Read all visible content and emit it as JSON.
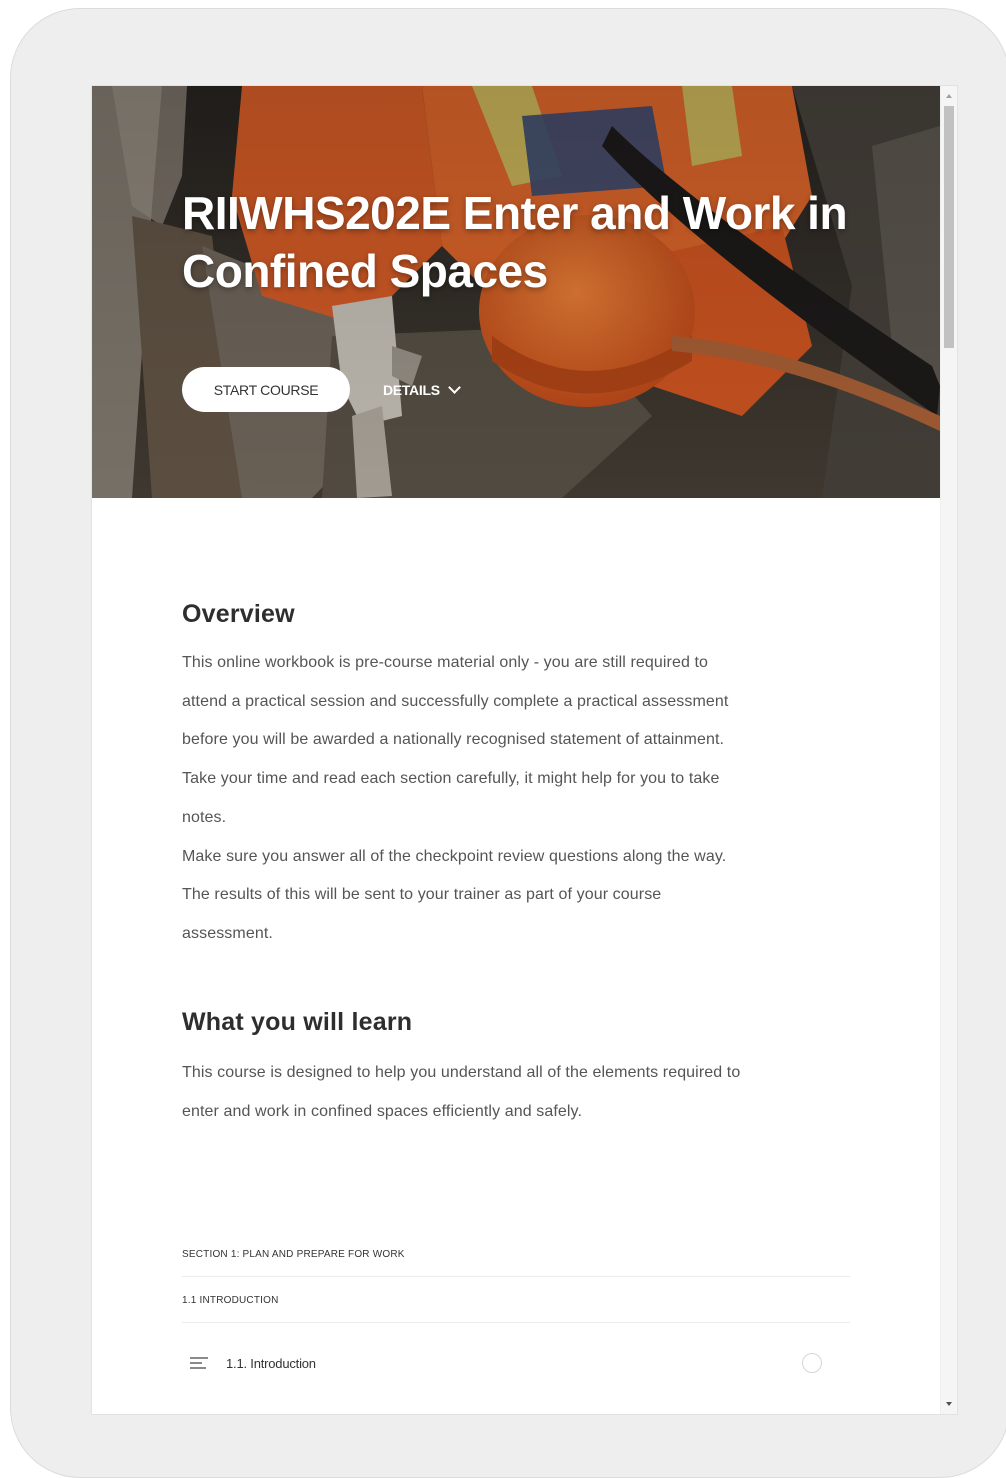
{
  "course": {
    "title": "RIIWHS202E Enter and Work in Confined Spaces",
    "start_label": "START COURSE",
    "details_label": "DETAILS"
  },
  "overview": {
    "heading": "Overview",
    "lines": [
      "This online workbook is pre-course material only - you are still required to",
      "attend a practical session and successfully complete a practical assessment",
      "before you will be awarded a nationally recognised statement of attainment.",
      "Take your time and read each section carefully, it might help for you to take",
      "notes.",
      "Make sure you answer all of the checkpoint review questions along the way.",
      "The results of this will be sent to your trainer as part of your course",
      "assessment."
    ]
  },
  "learn": {
    "heading": "What you will learn",
    "lines": [
      "This course is designed to help you understand all of the elements required to",
      "enter and work in confined spaces efficiently and safely."
    ]
  },
  "outline": {
    "section": "SECTION 1: PLAN AND PREPARE FOR WORK",
    "subsection": "1.1 INTRODUCTION",
    "lesson": "1.1. Introduction"
  },
  "icons": {
    "details": "chevron-down-icon",
    "lesson": "text-lines-icon",
    "status": "circle-status-icon"
  },
  "colors": {
    "hero_orange": "#e8642a",
    "button_bg": "#ffffff",
    "text_primary": "#2e2e2e",
    "text_body": "#555555",
    "device_frame": "#eeeeee"
  }
}
